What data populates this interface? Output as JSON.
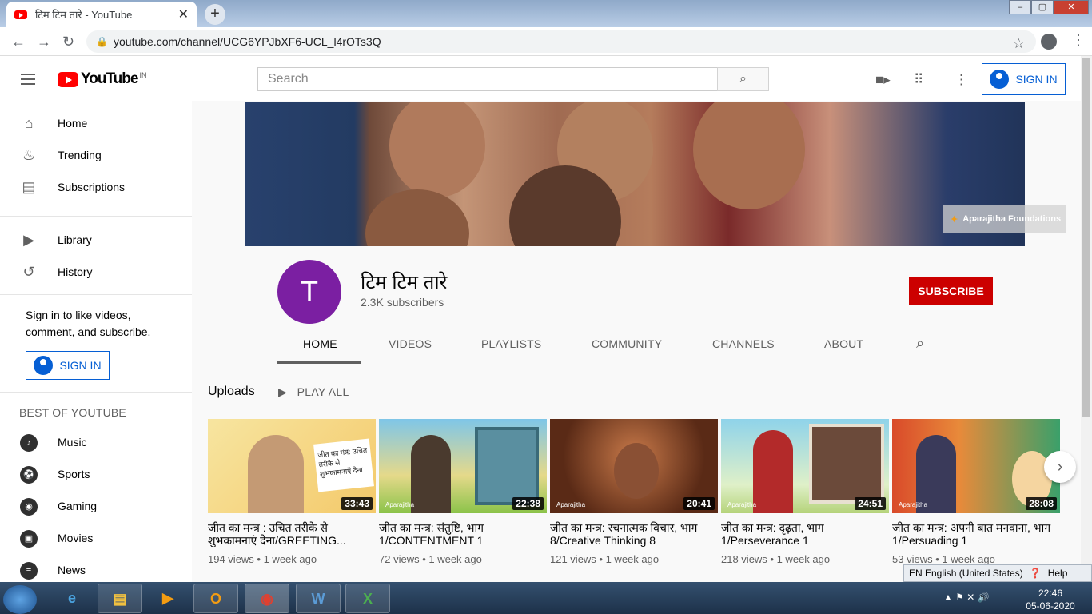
{
  "browser": {
    "tab_title": "टिम टिम तारे - YouTube",
    "close_tab": "✕",
    "new_tab": "+",
    "url": "youtube.com/channel/UCG6YPJbXF6-UCL_l4rOTs3Q",
    "window_buttons": {
      "minimize": "–",
      "maximize": "▢",
      "close": "✕"
    }
  },
  "header": {
    "logo_text": "YouTube",
    "country_code": "IN",
    "search_placeholder": "Search",
    "sign_in": "SIGN IN"
  },
  "sidebar": {
    "main": [
      {
        "label": "Home",
        "icon": "home-icon"
      },
      {
        "label": "Trending",
        "icon": "flame-icon"
      },
      {
        "label": "Subscriptions",
        "icon": "subscriptions-icon"
      }
    ],
    "library": [
      {
        "label": "Library",
        "icon": "library-icon"
      },
      {
        "label": "History",
        "icon": "history-icon"
      }
    ],
    "sign_in_message": "Sign in to like videos, comment, and subscribe.",
    "sign_in_button": "SIGN IN",
    "best_heading": "BEST OF YOUTUBE",
    "best": [
      {
        "label": "Music",
        "icon": "music-icon"
      },
      {
        "label": "Sports",
        "icon": "sports-icon"
      },
      {
        "label": "Gaming",
        "icon": "gaming-icon"
      },
      {
        "label": "Movies",
        "icon": "movies-icon"
      },
      {
        "label": "News",
        "icon": "news-icon"
      }
    ]
  },
  "banner": {
    "badge": "Aparajitha Foundations"
  },
  "channel": {
    "avatar_letter": "T",
    "avatar_color": "#7b1fa2",
    "name": "टिम टिम तारे",
    "subscribers": "2.3K subscribers",
    "subscribe": "SUBSCRIBE",
    "tabs": [
      "HOME",
      "VIDEOS",
      "PLAYLISTS",
      "COMMUNITY",
      "CHANNELS",
      "ABOUT"
    ],
    "active_tab": "HOME"
  },
  "uploads": {
    "title": "Uploads",
    "play_all": "PLAY ALL",
    "videos": [
      {
        "title": "जीत का मन्त्र : उचित तरीके से शुभकामनाएं देना/GREETING...",
        "duration": "33:43",
        "views": "194 views",
        "age": "1 week ago",
        "thumb_text": "जीत का मंत्र: उचित तरीके से शुभकामनाएँ देना"
      },
      {
        "title": "जीत का मन्त्र: संतुष्टि, भाग 1/CONTENTMENT 1",
        "duration": "22:38",
        "views": "72 views",
        "age": "1 week ago",
        "thumb_text": "Aparajitha"
      },
      {
        "title": "जीत का मन्त्र: रचनात्मक विचार, भाग 8/Creative Thinking 8",
        "duration": "20:41",
        "views": "121 views",
        "age": "1 week ago",
        "thumb_text": "Aparajitha"
      },
      {
        "title": "जीत का मन्त्र: दृढ़ता, भाग 1/Perseverance 1",
        "duration": "24:51",
        "views": "218 views",
        "age": "1 week ago",
        "thumb_text": "Aparajitha"
      },
      {
        "title": "जीत का मन्त्र: अपनी बात मनवाना, भाग 1/Persuading 1",
        "duration": "28:08",
        "views": "53 views",
        "age": "1 week ago",
        "thumb_text": "Aparajitha"
      }
    ]
  },
  "language_bar": {
    "lang": "EN English (United States)",
    "help": "Help"
  },
  "taskbar": {
    "time": "22:46",
    "date": "05-06-2020"
  },
  "colors": {
    "youtube_red": "#ff0000",
    "subscribe_red": "#cc0000",
    "link_blue": "#065fd4"
  }
}
